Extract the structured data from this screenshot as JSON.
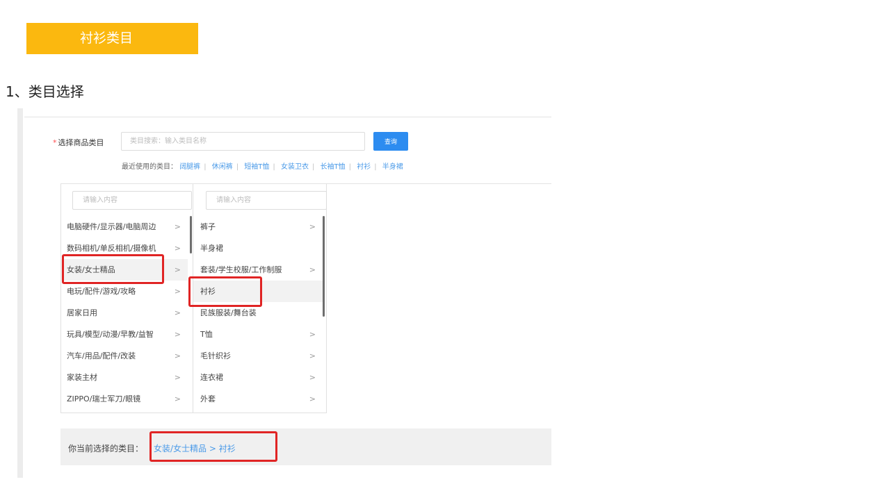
{
  "banner": {
    "title": "衬衫类目"
  },
  "section": {
    "heading": "1、类目选择"
  },
  "form": {
    "required_mark": "*",
    "label": "选择商品类目",
    "search_placeholder": "类目搜索：输入类目名称",
    "query_button": "查询",
    "recent_label": "最近使用的类目：",
    "recent_items": [
      "阔腿裤",
      "休闲裤",
      "短袖T恤",
      "女装卫衣",
      "长袖T恤",
      "衬衫",
      "半身裙"
    ],
    "recent_separator": "|"
  },
  "cascader": {
    "column1": {
      "placeholder": "请输入内容",
      "items": [
        {
          "label": "电脑硬件/显示器/电脑周边",
          "arrow": ">"
        },
        {
          "label": "数码相机/单反相机/摄像机",
          "arrow": ">"
        },
        {
          "label": "女装/女士精品",
          "arrow": ">"
        },
        {
          "label": "电玩/配件/游戏/攻略",
          "arrow": ">"
        },
        {
          "label": "居家日用",
          "arrow": ">"
        },
        {
          "label": "玩具/模型/动漫/早教/益智",
          "arrow": ">"
        },
        {
          "label": "汽车/用品/配件/改装",
          "arrow": ">"
        },
        {
          "label": "家装主材",
          "arrow": ">"
        },
        {
          "label": "ZIPPO/瑞士军刀/眼镜",
          "arrow": ">"
        }
      ]
    },
    "column2": {
      "placeholder": "请输入内容",
      "items": [
        {
          "label": "裤子",
          "arrow": ">"
        },
        {
          "label": "半身裙",
          "arrow": ""
        },
        {
          "label": "套装/学生校服/工作制服",
          "arrow": ">"
        },
        {
          "label": "衬衫",
          "arrow": ""
        },
        {
          "label": "民族服装/舞台装",
          "arrow": ""
        },
        {
          "label": "T恤",
          "arrow": ">"
        },
        {
          "label": "毛针织衫",
          "arrow": ">"
        },
        {
          "label": "连衣裙",
          "arrow": ">"
        },
        {
          "label": "外套",
          "arrow": ">"
        }
      ]
    }
  },
  "selection": {
    "label": "你当前选择的类目：",
    "value": "女装/女士精品 > 衬衫"
  },
  "colors": {
    "banner": "#fbb80f",
    "primary": "#2d8cf0",
    "link": "#4a9ae8",
    "highlight": "#e02424"
  }
}
